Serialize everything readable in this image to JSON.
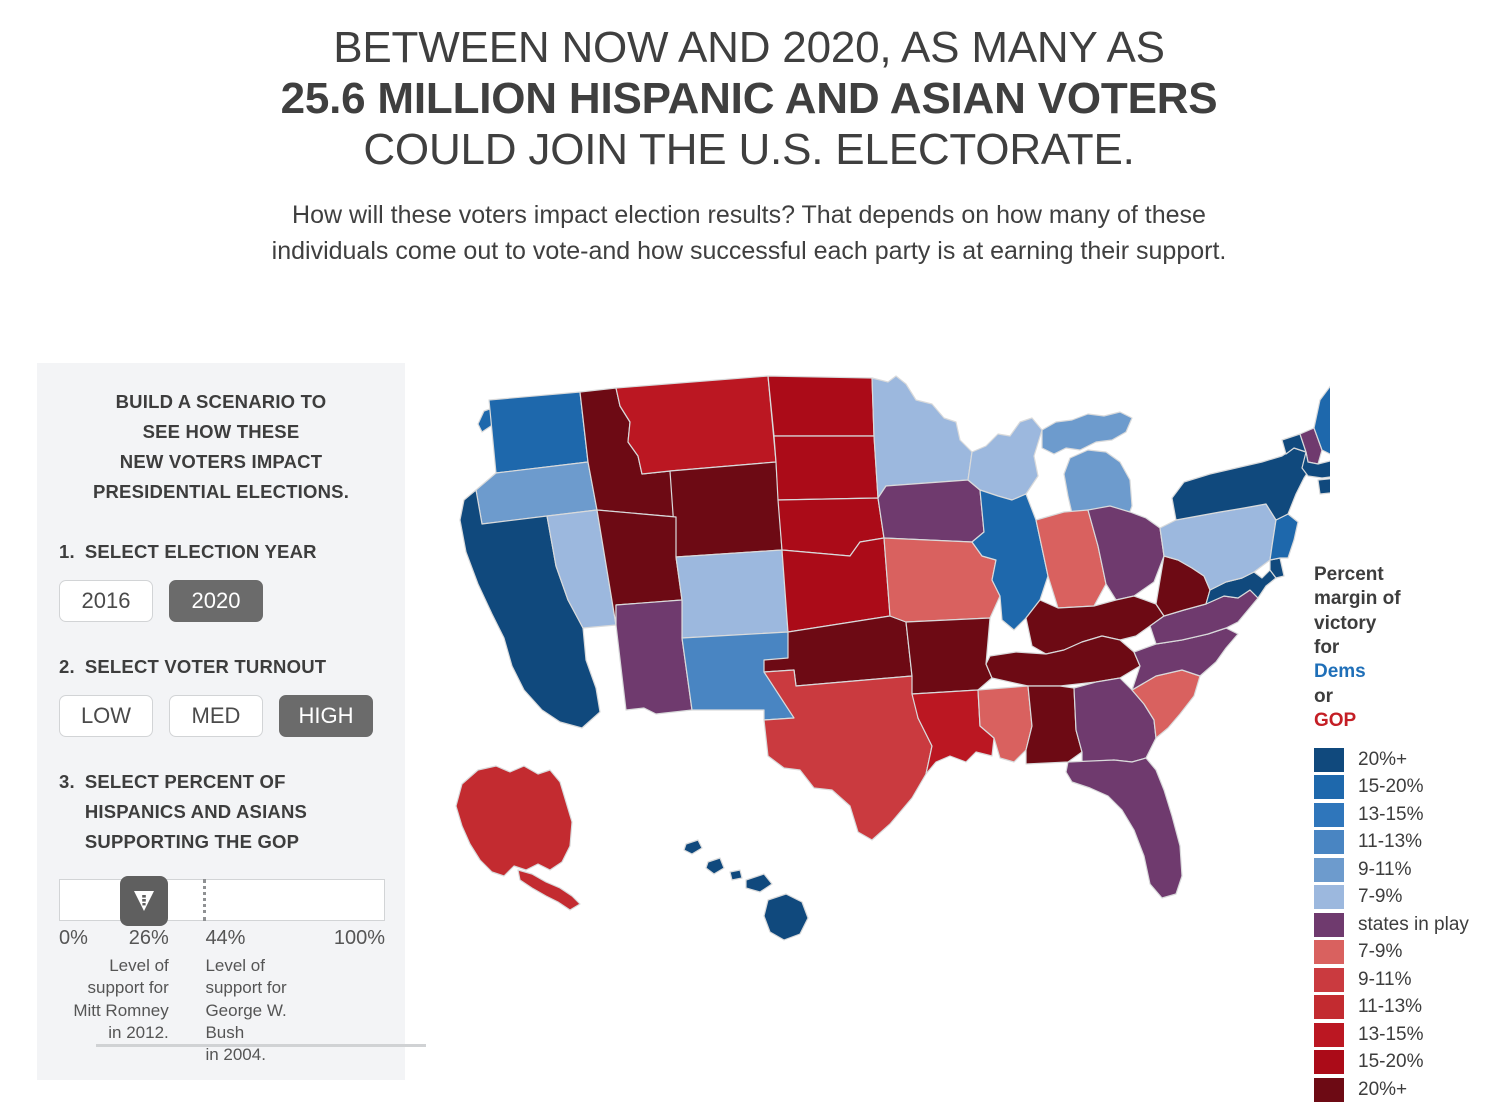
{
  "header": {
    "line1": "BETWEEN NOW AND 2020, AS MANY AS",
    "line2": "25.6 MILLION HISPANIC AND ASIAN VOTERS",
    "line3": "COULD JOIN THE U.S. ELECTORATE.",
    "sub1": "How will these voters impact election results? That depends on how many of these",
    "sub2": "individuals come out to vote-and how successful each party is at earning their support."
  },
  "sidebar": {
    "panel_title": [
      "BUILD A SCENARIO TO",
      "SEE HOW THESE",
      "NEW VOTERS IMPACT",
      "PRESIDENTIAL ELECTIONS."
    ],
    "step1": {
      "number": "1.",
      "label": [
        "SELECT ELECTION YEAR"
      ],
      "options": [
        {
          "label": "2016",
          "selected": false
        },
        {
          "label": "2020",
          "selected": true
        }
      ]
    },
    "step2": {
      "number": "2.",
      "label": [
        "SELECT VOTER TURNOUT"
      ],
      "options": [
        {
          "label": "LOW",
          "selected": false
        },
        {
          "label": "MED",
          "selected": false
        },
        {
          "label": "HIGH",
          "selected": true
        }
      ]
    },
    "step3": {
      "number": "3.",
      "label": [
        "SELECT PERCENT OF",
        "HISPANICS AND ASIANS",
        "SUPPORTING THE GOP"
      ],
      "slider": {
        "value_percent": 26,
        "marker_percent": 44,
        "min_label": "0%",
        "handle_label": "26%",
        "marker_label": "44%",
        "max_label": "100%",
        "note_left": [
          "Level of",
          "support for",
          "Mitt Romney",
          "in 2012."
        ],
        "note_right": [
          "Level of",
          "support for",
          "George W. Bush",
          "in 2004."
        ]
      }
    }
  },
  "legend": {
    "title": [
      "Percent",
      "margin of",
      "victory"
    ],
    "title_line4_prefix": "for ",
    "title_line4_dems": "Dems",
    "title_line5_prefix": "or ",
    "title_line5_gop": "GOP",
    "items": [
      {
        "label": "20%+",
        "color": "#10497d"
      },
      {
        "label": "15-20%",
        "color": "#1e68ac"
      },
      {
        "label": "13-15%",
        "color": "#2f76bb"
      },
      {
        "label": "11-13%",
        "color": "#4985c2"
      },
      {
        "label": "9-11%",
        "color": "#6d9bcd"
      },
      {
        "label": "7-9%",
        "color": "#9cb8de"
      },
      {
        "label": "states in play",
        "color": "#6f3a6e"
      },
      {
        "label": "7-9%",
        "color": "#d9615f"
      },
      {
        "label": "9-11%",
        "color": "#ca3a3f"
      },
      {
        "label": "11-13%",
        "color": "#c32b30"
      },
      {
        "label": "13-15%",
        "color": "#bb1722"
      },
      {
        "label": "15-20%",
        "color": "#ab0b18"
      },
      {
        "label": "20%+",
        "color": "#6d0a14"
      }
    ]
  },
  "chart_data": {
    "type": "map",
    "title": "Percent margin of victory for Dems or GOP",
    "projection": "us-albers",
    "legend_position": "right",
    "scenario": {
      "year": "2020",
      "turnout": "HIGH",
      "gop_hispanic_asian_support_pct": 26
    },
    "color_scale": {
      "dem_20plus": "#10497d",
      "dem_15_20": "#1e68ac",
      "dem_13_15": "#2f76bb",
      "dem_11_13": "#4985c2",
      "dem_9_11": "#6d9bcd",
      "dem_7_9": "#9cb8de",
      "in_play": "#6f3a6e",
      "gop_7_9": "#d9615f",
      "gop_9_11": "#ca3a3f",
      "gop_11_13": "#c32b30",
      "gop_13_15": "#bb1722",
      "gop_15_20": "#ab0b18",
      "gop_20plus": "#6d0a14"
    },
    "states": {
      "AK": {
        "name": "Alaska",
        "bucket": "gop_11_13",
        "color": "#c32b30"
      },
      "AL": {
        "name": "Alabama",
        "bucket": "gop_20plus",
        "color": "#6d0a14"
      },
      "AR": {
        "name": "Arkansas",
        "bucket": "gop_20plus",
        "color": "#6d0a14"
      },
      "AZ": {
        "name": "Arizona",
        "bucket": "in_play",
        "color": "#6f3a6e"
      },
      "CA": {
        "name": "California",
        "bucket": "dem_20plus",
        "color": "#10497d"
      },
      "CO": {
        "name": "Colorado",
        "bucket": "dem_7_9",
        "color": "#9cb8de"
      },
      "CT": {
        "name": "Connecticut",
        "bucket": "dem_20plus",
        "color": "#10497d"
      },
      "DE": {
        "name": "Delaware",
        "bucket": "dem_20plus",
        "color": "#10497d"
      },
      "FL": {
        "name": "Florida",
        "bucket": "in_play",
        "color": "#6f3a6e"
      },
      "GA": {
        "name": "Georgia",
        "bucket": "in_play",
        "color": "#6f3a6e"
      },
      "HI": {
        "name": "Hawaii",
        "bucket": "dem_20plus",
        "color": "#10497d"
      },
      "IA": {
        "name": "Iowa",
        "bucket": "in_play",
        "color": "#6f3a6e"
      },
      "ID": {
        "name": "Idaho",
        "bucket": "gop_20plus",
        "color": "#6d0a14"
      },
      "IL": {
        "name": "Illinois",
        "bucket": "dem_15_20",
        "color": "#1e68ac"
      },
      "IN": {
        "name": "Indiana",
        "bucket": "gop_7_9",
        "color": "#d9615f"
      },
      "KS": {
        "name": "Kansas",
        "bucket": "gop_15_20",
        "color": "#ab0b18"
      },
      "KY": {
        "name": "Kentucky",
        "bucket": "gop_20plus",
        "color": "#6d0a14"
      },
      "LA": {
        "name": "Louisiana",
        "bucket": "gop_13_15",
        "color": "#bb1722"
      },
      "MA": {
        "name": "Massachusetts",
        "bucket": "dem_20plus",
        "color": "#10497d"
      },
      "MD": {
        "name": "Maryland",
        "bucket": "dem_20plus",
        "color": "#10497d"
      },
      "ME": {
        "name": "Maine",
        "bucket": "dem_15_20",
        "color": "#1e68ac"
      },
      "MI": {
        "name": "Michigan",
        "bucket": "dem_9_11",
        "color": "#6d9bcd"
      },
      "MN": {
        "name": "Minnesota",
        "bucket": "dem_7_9",
        "color": "#9cb8de"
      },
      "MO": {
        "name": "Missouri",
        "bucket": "gop_7_9",
        "color": "#d9615f"
      },
      "MS": {
        "name": "Mississippi",
        "bucket": "gop_7_9",
        "color": "#d9615f"
      },
      "MT": {
        "name": "Montana",
        "bucket": "gop_13_15",
        "color": "#bb1722"
      },
      "NC": {
        "name": "North Carolina",
        "bucket": "in_play",
        "color": "#6f3a6e"
      },
      "ND": {
        "name": "North Dakota",
        "bucket": "gop_15_20",
        "color": "#ab0b18"
      },
      "NE": {
        "name": "Nebraska",
        "bucket": "gop_15_20",
        "color": "#ab0b18"
      },
      "NH": {
        "name": "New Hampshire",
        "bucket": "in_play",
        "color": "#6f3a6e"
      },
      "NJ": {
        "name": "New Jersey",
        "bucket": "dem_15_20",
        "color": "#1e68ac"
      },
      "NM": {
        "name": "New Mexico",
        "bucket": "dem_11_13",
        "color": "#4985c2"
      },
      "NV": {
        "name": "Nevada",
        "bucket": "dem_7_9",
        "color": "#9cb8de"
      },
      "NY": {
        "name": "New York",
        "bucket": "dem_20plus",
        "color": "#10497d"
      },
      "OH": {
        "name": "Ohio",
        "bucket": "in_play",
        "color": "#6f3a6e"
      },
      "OK": {
        "name": "Oklahoma",
        "bucket": "gop_20plus",
        "color": "#6d0a14"
      },
      "OR": {
        "name": "Oregon",
        "bucket": "dem_9_11",
        "color": "#6d9bcd"
      },
      "PA": {
        "name": "Pennsylvania",
        "bucket": "dem_7_9",
        "color": "#9cb8de"
      },
      "RI": {
        "name": "Rhode Island",
        "bucket": "dem_15_20",
        "color": "#1e68ac"
      },
      "SC": {
        "name": "South Carolina",
        "bucket": "gop_7_9",
        "color": "#d9615f"
      },
      "SD": {
        "name": "South Dakota",
        "bucket": "gop_15_20",
        "color": "#ab0b18"
      },
      "TN": {
        "name": "Tennessee",
        "bucket": "gop_20plus",
        "color": "#6d0a14"
      },
      "TX": {
        "name": "Texas",
        "bucket": "gop_9_11",
        "color": "#ca3a3f"
      },
      "UT": {
        "name": "Utah",
        "bucket": "gop_20plus",
        "color": "#6d0a14"
      },
      "VA": {
        "name": "Virginia",
        "bucket": "in_play",
        "color": "#6f3a6e"
      },
      "VT": {
        "name": "Vermont",
        "bucket": "dem_20plus",
        "color": "#10497d"
      },
      "WA": {
        "name": "Washington",
        "bucket": "dem_15_20",
        "color": "#1e68ac"
      },
      "WI": {
        "name": "Wisconsin",
        "bucket": "dem_7_9",
        "color": "#9cb8de"
      },
      "WV": {
        "name": "West Virginia",
        "bucket": "gop_20plus",
        "color": "#6d0a14"
      },
      "WY": {
        "name": "Wyoming",
        "bucket": "gop_20plus",
        "color": "#6d0a14"
      }
    }
  }
}
